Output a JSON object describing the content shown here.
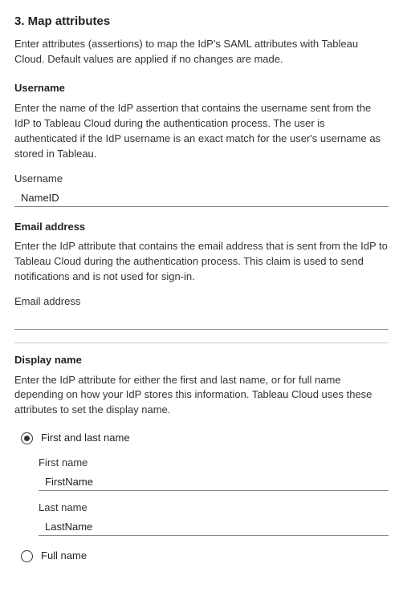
{
  "section": {
    "title": "3. Map attributes",
    "desc": "Enter attributes (assertions) to map the IdP's SAML attributes with Tableau Cloud. Default values are applied if no changes are made."
  },
  "username": {
    "heading": "Username",
    "desc": "Enter the name of the IdP assertion that contains the username sent from the IdP to Tableau Cloud during the authentication process. The user is authenticated if the IdP username is an exact match for the user's username as stored in Tableau.",
    "label": "Username",
    "value": "NameID"
  },
  "email": {
    "heading": "Email address",
    "desc": "Enter the IdP attribute that contains the email address that is sent from the IdP to Tableau Cloud during the authentication process. This claim is used to send notifications and is not used for sign-in.",
    "label": "Email address",
    "value": ""
  },
  "display_name": {
    "heading": "Display name",
    "desc": "Enter the IdP attribute for either the first and last name, or for full name depending on how your IdP stores this information. Tableau Cloud uses these attributes to set the display name.",
    "option_first_last": "First and last name",
    "option_full": "Full name",
    "first_name_label": "First name",
    "first_name_value": "FirstName",
    "last_name_label": "Last name",
    "last_name_value": "LastName"
  }
}
